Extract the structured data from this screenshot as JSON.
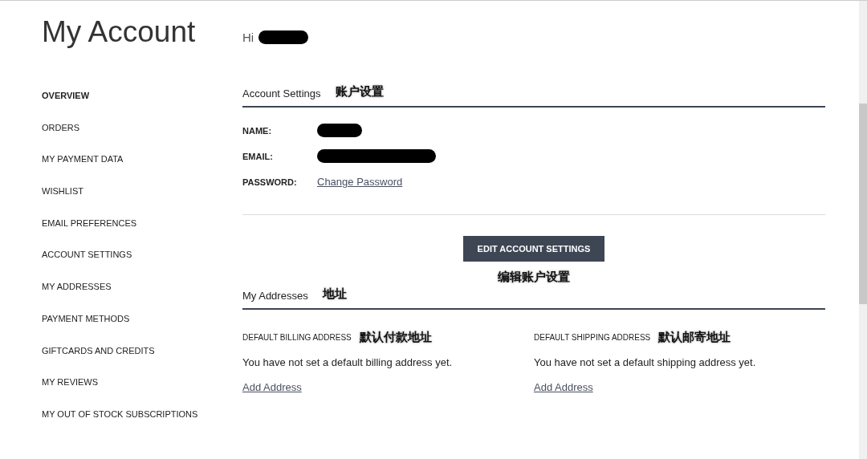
{
  "page_title": "My Account",
  "greeting": "Hi",
  "sidebar": {
    "items": [
      {
        "label": "OVERVIEW",
        "selected": true
      },
      {
        "label": "ORDERS",
        "selected": false
      },
      {
        "label": "MY PAYMENT DATA",
        "selected": false
      },
      {
        "label": "WISHLIST",
        "selected": false
      },
      {
        "label": "EMAIL PREFERENCES",
        "selected": false
      },
      {
        "label": "ACCOUNT SETTINGS",
        "selected": false
      },
      {
        "label": "MY ADDRESSES",
        "selected": false
      },
      {
        "label": "PAYMENT METHODS",
        "selected": false
      },
      {
        "label": "GIFTCARDS AND CREDITS",
        "selected": false
      },
      {
        "label": "MY REVIEWS",
        "selected": false
      },
      {
        "label": "MY OUT OF STOCK SUBSCRIPTIONS",
        "selected": false
      }
    ]
  },
  "account_settings": {
    "heading": "Account Settings",
    "note": "账户设置",
    "fields": [
      {
        "label": "NAME:",
        "kind": "redacted"
      },
      {
        "label": "EMAIL:",
        "kind": "redacted"
      },
      {
        "label": "PASSWORD:",
        "kind": "link",
        "link": "Change Password"
      }
    ],
    "button": "EDIT ACCOUNT SETTINGS",
    "button_note": "编辑账户设置"
  },
  "addresses": {
    "heading": "My Addresses",
    "note": "地址",
    "columns": [
      {
        "label": "DEFAULT BILLING ADDRESS",
        "note": "默认付款地址",
        "text": "You have not set a default billing address yet.",
        "link": "Add Address"
      },
      {
        "label": "DEFAULT SHIPPING ADDRESS",
        "note": "默认邮寄地址",
        "text": "You have not set a default shipping address yet.",
        "link": "Add Address"
      }
    ]
  }
}
